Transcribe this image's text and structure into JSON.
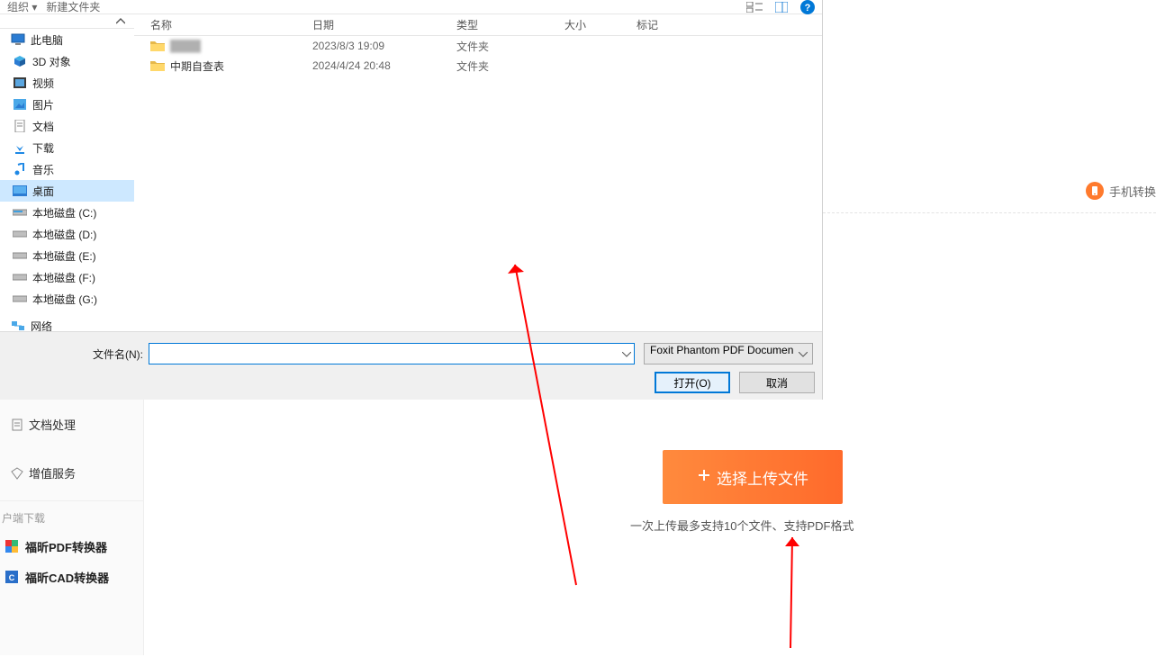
{
  "dialog": {
    "top": {
      "organize": "组织 ▾",
      "new_folder": "新建文件夹"
    },
    "nav": {
      "items": [
        {
          "label": "此电脑",
          "key": "this-pc"
        },
        {
          "label": "3D 对象",
          "key": "3d-objects"
        },
        {
          "label": "视频",
          "key": "videos"
        },
        {
          "label": "图片",
          "key": "pictures"
        },
        {
          "label": "文档",
          "key": "documents"
        },
        {
          "label": "下载",
          "key": "downloads"
        },
        {
          "label": "音乐",
          "key": "music"
        },
        {
          "label": "桌面",
          "key": "desktop",
          "selected": true
        },
        {
          "label": "本地磁盘 (C:)",
          "key": "c"
        },
        {
          "label": "本地磁盘 (D:)",
          "key": "d"
        },
        {
          "label": "本地磁盘 (E:)",
          "key": "e"
        },
        {
          "label": "本地磁盘 (F:)",
          "key": "f"
        },
        {
          "label": "本地磁盘 (G:)",
          "key": "g"
        }
      ],
      "network": "网络"
    },
    "columns": {
      "name": "名称",
      "date": "日期",
      "type": "类型",
      "size": "大小",
      "tag": "标记"
    },
    "rows": [
      {
        "name": "████",
        "date": "2023/8/3 19:09",
        "type": "文件夹",
        "blur": true
      },
      {
        "name": "中期自查表",
        "date": "2024/4/24 20:48",
        "type": "文件夹"
      }
    ],
    "filename_label": "文件名(N):",
    "filename_value": "",
    "filetype": "Foxit Phantom PDF Documen",
    "btn_open": "打开(O)",
    "btn_cancel": "取消"
  },
  "sidebar": {
    "doc_processing": "文档处理",
    "premium": "增值服务",
    "client_header": "户端下载",
    "pdf_converter": "福昕PDF转换器",
    "cad_converter": "福昕CAD转换器"
  },
  "page": {
    "mobile_convert": "手机转换",
    "upload_label": "选择上传文件",
    "upload_hint": "一次上传最多支持10个文件、支持PDF格式"
  }
}
